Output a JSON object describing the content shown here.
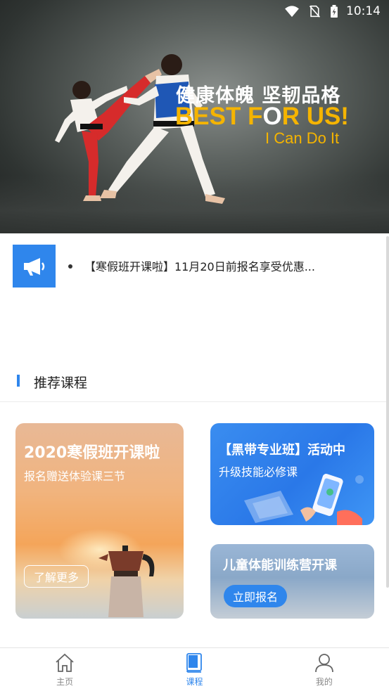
{
  "status_bar": {
    "time": "10:14",
    "icons": [
      "wifi-icon",
      "no-sim-icon",
      "battery-icon"
    ]
  },
  "banner": {
    "title_cn": "健康体魄 坚韧品格",
    "title_en_part1": "BEST F",
    "title_en_o": "O",
    "title_en_part2": "R US!",
    "subtitle": "I Can Do It",
    "colors": {
      "accent": "#f5b400"
    }
  },
  "notice": {
    "icon": "megaphone-icon",
    "text": "【寒假班开课啦】11月20日前报名享受优惠..."
  },
  "section": {
    "title": "推荐课程"
  },
  "cards": {
    "winter": {
      "title": "2020寒假班开课啦",
      "subtitle": "报名赠送体验课三节",
      "button": "了解更多"
    },
    "blackbelt": {
      "title": "【黑带专业班】活动中",
      "subtitle": "升级技能必修课"
    },
    "kids": {
      "title": "儿童体能训练营开课",
      "button": "立即报名"
    }
  },
  "bottom_nav": {
    "items": [
      {
        "label": "主页",
        "icon": "home-icon",
        "active": false
      },
      {
        "label": "课程",
        "icon": "book-icon",
        "active": true
      },
      {
        "label": "我的",
        "icon": "user-icon",
        "active": false
      }
    ]
  },
  "colors": {
    "primary": "#2f86ec",
    "inactive": "#888888"
  }
}
